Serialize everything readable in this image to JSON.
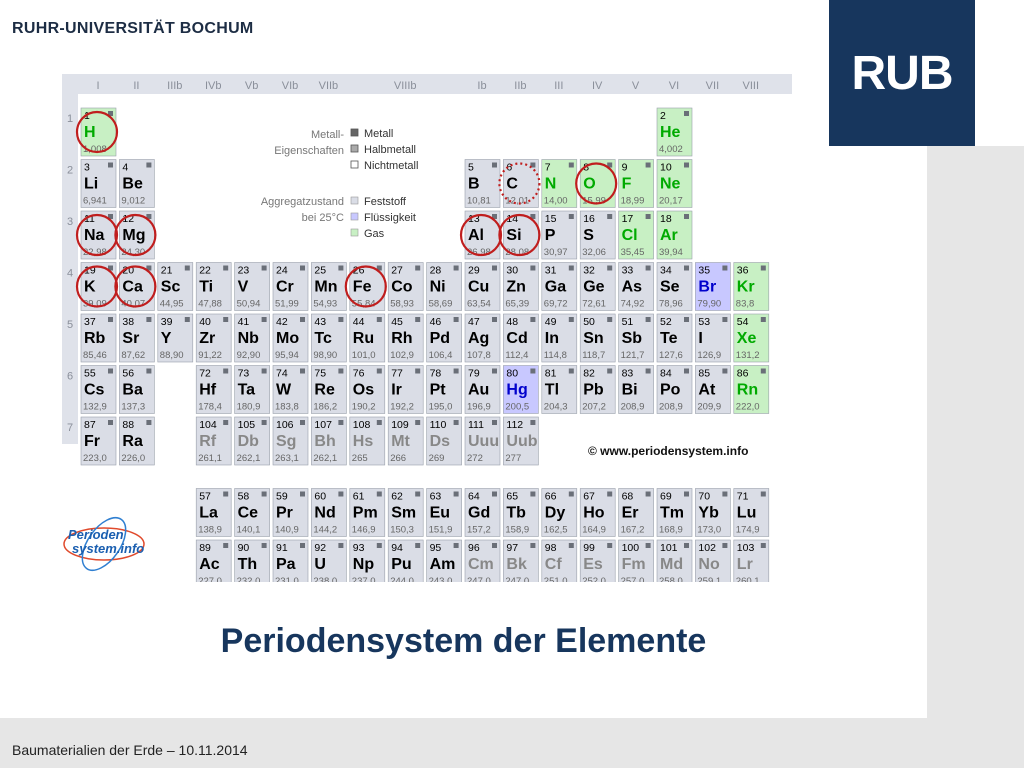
{
  "header": {
    "university": "RUHR-UNIVERSITÄT BOCHUM",
    "logo": "RUB"
  },
  "slide_title": "Periodensystem der Elemente",
  "footer": "Baumaterialien der Erde – 10.11.2014",
  "table": {
    "group_labels": [
      "I",
      "II",
      "IIIb",
      "IVb",
      "Vb",
      "VIb",
      "VIIb",
      "VIIIb",
      "Ib",
      "IIb",
      "III",
      "IV",
      "V",
      "VI",
      "VII",
      "VIII"
    ],
    "period_labels": [
      "1",
      "2",
      "3",
      "4",
      "5",
      "6",
      "7"
    ],
    "legend": {
      "metal_props_title": "Metall-\nEigenschaften",
      "metal_props": [
        "Metall",
        "Halbmetall",
        "Nichtmetall"
      ],
      "state_title": "Aggregatzustand\nbei 25°C",
      "states": [
        "Feststoff",
        "Flüssigkeit",
        "Gas"
      ]
    },
    "copyright": "© www.periodensystem.info",
    "logo_text": [
      "Perioden",
      "system.info"
    ],
    "colors": {
      "cell_grey": "#dadde6",
      "cell_green": "#c8f0c4",
      "cell_blue": "#c8c8ff",
      "ring": "#c01e1e",
      "number": "#000000",
      "symbol_green": "#00aa00",
      "symbol_blue": "#0000cc",
      "symbol_grey": "#888888"
    },
    "elements": [
      {
        "n": "1",
        "s": "H",
        "m": "1,008",
        "r": 0,
        "c": 0,
        "t": "gas",
        "circle": "solid"
      },
      {
        "n": "2",
        "s": "He",
        "m": "4,002",
        "r": 0,
        "c": 15,
        "t": "gas"
      },
      {
        "n": "3",
        "s": "Li",
        "m": "6,941",
        "r": 1,
        "c": 0
      },
      {
        "n": "4",
        "s": "Be",
        "m": "9,012",
        "r": 1,
        "c": 1
      },
      {
        "n": "5",
        "s": "B",
        "m": "10,81",
        "r": 1,
        "c": 10
      },
      {
        "n": "6",
        "s": "C",
        "m": "12,01",
        "r": 1,
        "c": 11,
        "circle": "dotted"
      },
      {
        "n": "7",
        "s": "N",
        "m": "14,00",
        "r": 1,
        "c": 12,
        "t": "gas"
      },
      {
        "n": "8",
        "s": "O",
        "m": "15,99",
        "r": 1,
        "c": 13,
        "t": "gas",
        "circle": "solid"
      },
      {
        "n": "9",
        "s": "F",
        "m": "18,99",
        "r": 1,
        "c": 14,
        "t": "gas"
      },
      {
        "n": "10",
        "s": "Ne",
        "m": "20,17",
        "r": 1,
        "c": 15,
        "t": "gas"
      },
      {
        "n": "11",
        "s": "Na",
        "m": "22,98",
        "r": 2,
        "c": 0,
        "circle": "solid"
      },
      {
        "n": "12",
        "s": "Mg",
        "m": "24,30",
        "r": 2,
        "c": 1,
        "circle": "solid"
      },
      {
        "n": "13",
        "s": "Al",
        "m": "26,98",
        "r": 2,
        "c": 10,
        "circle": "solid"
      },
      {
        "n": "14",
        "s": "Si",
        "m": "28,08",
        "r": 2,
        "c": 11,
        "circle": "solid"
      },
      {
        "n": "15",
        "s": "P",
        "m": "30,97",
        "r": 2,
        "c": 12
      },
      {
        "n": "16",
        "s": "S",
        "m": "32,06",
        "r": 2,
        "c": 13
      },
      {
        "n": "17",
        "s": "Cl",
        "m": "35,45",
        "r": 2,
        "c": 14,
        "t": "gas"
      },
      {
        "n": "18",
        "s": "Ar",
        "m": "39,94",
        "r": 2,
        "c": 15,
        "t": "gas"
      },
      {
        "n": "19",
        "s": "K",
        "m": "39,09",
        "r": 3,
        "c": 0,
        "circle": "solid"
      },
      {
        "n": "20",
        "s": "Ca",
        "m": "40,07",
        "r": 3,
        "c": 1,
        "circle": "solid"
      },
      {
        "n": "21",
        "s": "Sc",
        "m": "44,95",
        "r": 3,
        "c": 2
      },
      {
        "n": "22",
        "s": "Ti",
        "m": "47,88",
        "r": 3,
        "c": 3
      },
      {
        "n": "23",
        "s": "V",
        "m": "50,94",
        "r": 3,
        "c": 4
      },
      {
        "n": "24",
        "s": "Cr",
        "m": "51,99",
        "r": 3,
        "c": 5
      },
      {
        "n": "25",
        "s": "Mn",
        "m": "54,93",
        "r": 3,
        "c": 6
      },
      {
        "n": "26",
        "s": "Fe",
        "m": "55,84",
        "r": 3,
        "c": 7,
        "circle": "solid"
      },
      {
        "n": "27",
        "s": "Co",
        "m": "58,93",
        "r": 3,
        "c": 8
      },
      {
        "n": "28",
        "s": "Ni",
        "m": "58,69",
        "r": 3,
        "c": 9
      },
      {
        "n": "29",
        "s": "Cu",
        "m": "63,54",
        "r": 3,
        "c": 10
      },
      {
        "n": "30",
        "s": "Zn",
        "m": "65,39",
        "r": 3,
        "c": 11
      },
      {
        "n": "31",
        "s": "Ga",
        "m": "69,72",
        "r": 3,
        "c": 12
      },
      {
        "n": "32",
        "s": "Ge",
        "m": "72,61",
        "r": 3,
        "c": 13
      },
      {
        "n": "33",
        "s": "As",
        "m": "74,92",
        "r": 3,
        "c": 14
      },
      {
        "n": "34",
        "s": "Se",
        "m": "78,96",
        "r": 3,
        "c": 15
      },
      {
        "n": "35",
        "s": "Br",
        "m": "79,90",
        "r": 3,
        "c": 16,
        "t": "liquid"
      },
      {
        "n": "36",
        "s": "Kr",
        "m": "83,8",
        "r": 3,
        "c": 17,
        "t": "gas"
      },
      {
        "n": "37",
        "s": "Rb",
        "m": "85,46",
        "r": 4,
        "c": 0
      },
      {
        "n": "38",
        "s": "Sr",
        "m": "87,62",
        "r": 4,
        "c": 1
      },
      {
        "n": "39",
        "s": "Y",
        "m": "88,90",
        "r": 4,
        "c": 2
      },
      {
        "n": "40",
        "s": "Zr",
        "m": "91,22",
        "r": 4,
        "c": 3
      },
      {
        "n": "41",
        "s": "Nb",
        "m": "92,90",
        "r": 4,
        "c": 4
      },
      {
        "n": "42",
        "s": "Mo",
        "m": "95,94",
        "r": 4,
        "c": 5
      },
      {
        "n": "43",
        "s": "Tc",
        "m": "98,90",
        "r": 4,
        "c": 6
      },
      {
        "n": "44",
        "s": "Ru",
        "m": "101,0",
        "r": 4,
        "c": 7
      },
      {
        "n": "45",
        "s": "Rh",
        "m": "102,9",
        "r": 4,
        "c": 8
      },
      {
        "n": "46",
        "s": "Pd",
        "m": "106,4",
        "r": 4,
        "c": 9
      },
      {
        "n": "47",
        "s": "Ag",
        "m": "107,8",
        "r": 4,
        "c": 10
      },
      {
        "n": "48",
        "s": "Cd",
        "m": "112,4",
        "r": 4,
        "c": 11
      },
      {
        "n": "49",
        "s": "In",
        "m": "114,8",
        "r": 4,
        "c": 12
      },
      {
        "n": "50",
        "s": "Sn",
        "m": "118,7",
        "r": 4,
        "c": 13
      },
      {
        "n": "51",
        "s": "Sb",
        "m": "121,7",
        "r": 4,
        "c": 14
      },
      {
        "n": "52",
        "s": "Te",
        "m": "127,6",
        "r": 4,
        "c": 15
      },
      {
        "n": "53",
        "s": "I",
        "m": "126,9",
        "r": 4,
        "c": 16
      },
      {
        "n": "54",
        "s": "Xe",
        "m": "131,2",
        "r": 4,
        "c": 17,
        "t": "gas"
      },
      {
        "n": "55",
        "s": "Cs",
        "m": "132,9",
        "r": 5,
        "c": 0
      },
      {
        "n": "56",
        "s": "Ba",
        "m": "137,3",
        "r": 5,
        "c": 1
      },
      {
        "n": "72",
        "s": "Hf",
        "m": "178,4",
        "r": 5,
        "c": 3
      },
      {
        "n": "73",
        "s": "Ta",
        "m": "180,9",
        "r": 5,
        "c": 4
      },
      {
        "n": "74",
        "s": "W",
        "m": "183,8",
        "r": 5,
        "c": 5
      },
      {
        "n": "75",
        "s": "Re",
        "m": "186,2",
        "r": 5,
        "c": 6
      },
      {
        "n": "76",
        "s": "Os",
        "m": "190,2",
        "r": 5,
        "c": 7
      },
      {
        "n": "77",
        "s": "Ir",
        "m": "192,2",
        "r": 5,
        "c": 8
      },
      {
        "n": "78",
        "s": "Pt",
        "m": "195,0",
        "r": 5,
        "c": 9
      },
      {
        "n": "79",
        "s": "Au",
        "m": "196,9",
        "r": 5,
        "c": 10
      },
      {
        "n": "80",
        "s": "Hg",
        "m": "200,5",
        "r": 5,
        "c": 11,
        "t": "liquid"
      },
      {
        "n": "81",
        "s": "Tl",
        "m": "204,3",
        "r": 5,
        "c": 12
      },
      {
        "n": "82",
        "s": "Pb",
        "m": "207,2",
        "r": 5,
        "c": 13
      },
      {
        "n": "83",
        "s": "Bi",
        "m": "208,9",
        "r": 5,
        "c": 14
      },
      {
        "n": "84",
        "s": "Po",
        "m": "208,9",
        "r": 5,
        "c": 15
      },
      {
        "n": "85",
        "s": "At",
        "m": "209,9",
        "r": 5,
        "c": 16
      },
      {
        "n": "86",
        "s": "Rn",
        "m": "222,0",
        "r": 5,
        "c": 17,
        "t": "gas"
      },
      {
        "n": "87",
        "s": "Fr",
        "m": "223,0",
        "r": 6,
        "c": 0
      },
      {
        "n": "88",
        "s": "Ra",
        "m": "226,0",
        "r": 6,
        "c": 1
      },
      {
        "n": "104",
        "s": "Rf",
        "m": "261,1",
        "r": 6,
        "c": 3,
        "t": "synthetic"
      },
      {
        "n": "105",
        "s": "Db",
        "m": "262,1",
        "r": 6,
        "c": 4,
        "t": "synthetic"
      },
      {
        "n": "106",
        "s": "Sg",
        "m": "263,1",
        "r": 6,
        "c": 5,
        "t": "synthetic"
      },
      {
        "n": "107",
        "s": "Bh",
        "m": "262,1",
        "r": 6,
        "c": 6,
        "t": "synthetic"
      },
      {
        "n": "108",
        "s": "Hs",
        "m": "265",
        "r": 6,
        "c": 7,
        "t": "synthetic"
      },
      {
        "n": "109",
        "s": "Mt",
        "m": "266",
        "r": 6,
        "c": 8,
        "t": "synthetic"
      },
      {
        "n": "110",
        "s": "Ds",
        "m": "269",
        "r": 6,
        "c": 9,
        "t": "synthetic"
      },
      {
        "n": "111",
        "s": "Uuu",
        "m": "272",
        "r": 6,
        "c": 10,
        "t": "synthetic"
      },
      {
        "n": "112",
        "s": "Uub",
        "m": "277",
        "r": 6,
        "c": 11,
        "t": "synthetic"
      },
      {
        "n": "57",
        "s": "La",
        "m": "138,9",
        "r": 7,
        "c": 3
      },
      {
        "n": "58",
        "s": "Ce",
        "m": "140,1",
        "r": 7,
        "c": 4
      },
      {
        "n": "59",
        "s": "Pr",
        "m": "140,9",
        "r": 7,
        "c": 5
      },
      {
        "n": "60",
        "s": "Nd",
        "m": "144,2",
        "r": 7,
        "c": 6
      },
      {
        "n": "61",
        "s": "Pm",
        "m": "146,9",
        "r": 7,
        "c": 7
      },
      {
        "n": "62",
        "s": "Sm",
        "m": "150,3",
        "r": 7,
        "c": 8
      },
      {
        "n": "63",
        "s": "Eu",
        "m": "151,9",
        "r": 7,
        "c": 9
      },
      {
        "n": "64",
        "s": "Gd",
        "m": "157,2",
        "r": 7,
        "c": 10
      },
      {
        "n": "65",
        "s": "Tb",
        "m": "158,9",
        "r": 7,
        "c": 11
      },
      {
        "n": "66",
        "s": "Dy",
        "m": "162,5",
        "r": 7,
        "c": 12
      },
      {
        "n": "67",
        "s": "Ho",
        "m": "164,9",
        "r": 7,
        "c": 13
      },
      {
        "n": "68",
        "s": "Er",
        "m": "167,2",
        "r": 7,
        "c": 14
      },
      {
        "n": "69",
        "s": "Tm",
        "m": "168,9",
        "r": 7,
        "c": 15
      },
      {
        "n": "70",
        "s": "Yb",
        "m": "173,0",
        "r": 7,
        "c": 16
      },
      {
        "n": "71",
        "s": "Lu",
        "m": "174,9",
        "r": 7,
        "c": 17
      },
      {
        "n": "89",
        "s": "Ac",
        "m": "227,0",
        "r": 8,
        "c": 3
      },
      {
        "n": "90",
        "s": "Th",
        "m": "232,0",
        "r": 8,
        "c": 4
      },
      {
        "n": "91",
        "s": "Pa",
        "m": "231,0",
        "r": 8,
        "c": 5
      },
      {
        "n": "92",
        "s": "U",
        "m": "238,0",
        "r": 8,
        "c": 6
      },
      {
        "n": "93",
        "s": "Np",
        "m": "237,0",
        "r": 8,
        "c": 7
      },
      {
        "n": "94",
        "s": "Pu",
        "m": "244,0",
        "r": 8,
        "c": 8
      },
      {
        "n": "95",
        "s": "Am",
        "m": "243,0",
        "r": 8,
        "c": 9
      },
      {
        "n": "96",
        "s": "Cm",
        "m": "247,0",
        "r": 8,
        "c": 10,
        "t": "synthetic"
      },
      {
        "n": "97",
        "s": "Bk",
        "m": "247,0",
        "r": 8,
        "c": 11,
        "t": "synthetic"
      },
      {
        "n": "98",
        "s": "Cf",
        "m": "251,0",
        "r": 8,
        "c": 12,
        "t": "synthetic"
      },
      {
        "n": "99",
        "s": "Es",
        "m": "252,0",
        "r": 8,
        "c": 13,
        "t": "synthetic"
      },
      {
        "n": "100",
        "s": "Fm",
        "m": "257,0",
        "r": 8,
        "c": 14,
        "t": "synthetic"
      },
      {
        "n": "101",
        "s": "Md",
        "m": "258,0",
        "r": 8,
        "c": 15,
        "t": "synthetic"
      },
      {
        "n": "102",
        "s": "No",
        "m": "259,1",
        "r": 8,
        "c": 16,
        "t": "synthetic"
      },
      {
        "n": "103",
        "s": "Lr",
        "m": "260,1",
        "r": 8,
        "c": 17,
        "t": "synthetic"
      }
    ]
  }
}
